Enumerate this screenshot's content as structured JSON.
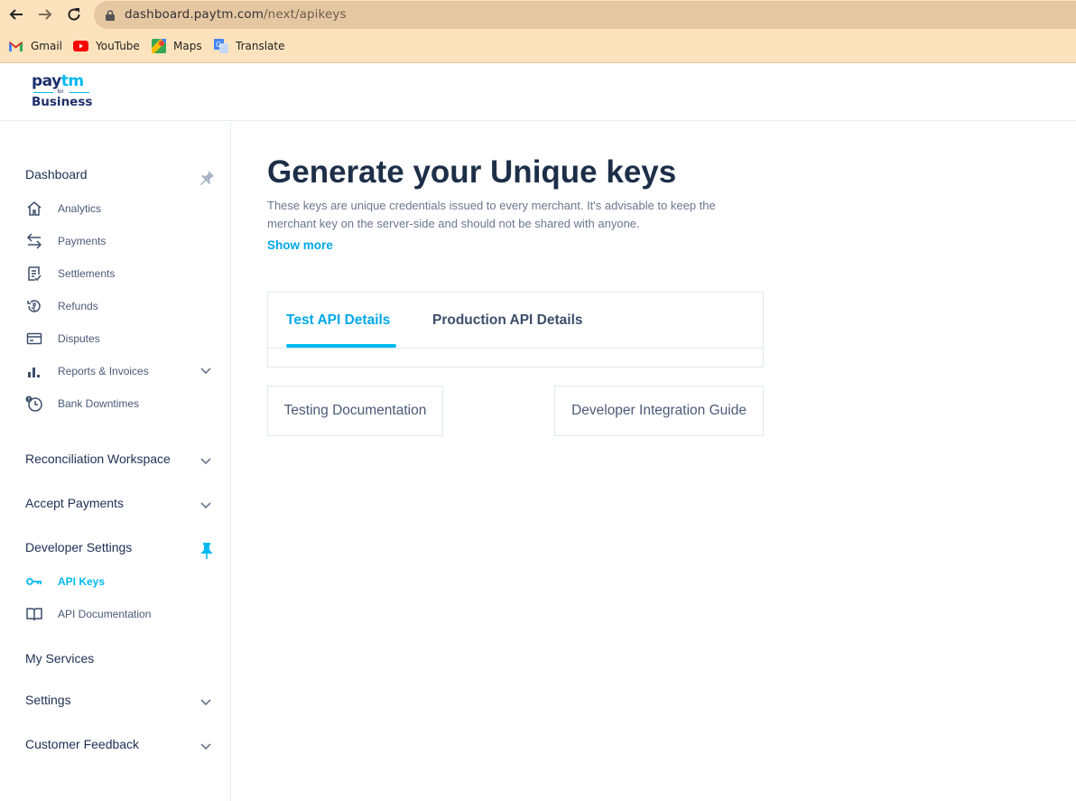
{
  "browser": {
    "url_host": "dashboard.paytm.com",
    "url_path": "/next/apikeys",
    "bookmarks": [
      {
        "label": "Gmail",
        "icon": "gmail-icon"
      },
      {
        "label": "YouTube",
        "icon": "youtube-icon"
      },
      {
        "label": "Maps",
        "icon": "maps-icon"
      },
      {
        "label": "Translate",
        "icon": "translate-icon"
      }
    ]
  },
  "logo": {
    "top": "pay",
    "top2": "tm",
    "for": "for",
    "bottom": "Business"
  },
  "sidebar": {
    "dashboard": "Dashboard",
    "items": [
      {
        "label": "Analytics",
        "icon": "home-icon"
      },
      {
        "label": "Payments",
        "icon": "transfer-arrows-icon"
      },
      {
        "label": "Settlements",
        "icon": "settlements-icon"
      },
      {
        "label": "Refunds",
        "icon": "refund-icon"
      },
      {
        "label": "Disputes",
        "icon": "card-icon"
      },
      {
        "label": "Reports & Invoices",
        "icon": "bar-chart-icon"
      },
      {
        "label": "Bank Downtimes",
        "icon": "clock-alert-icon"
      }
    ],
    "reconciliation": "Reconciliation Workspace",
    "accept_payments": "Accept Payments",
    "developer_settings": "Developer Settings",
    "dev_items": [
      {
        "label": "API Keys",
        "icon": "key-icon"
      },
      {
        "label": "API Documentation",
        "icon": "book-icon"
      }
    ],
    "my_services": "My Services",
    "settings": "Settings",
    "customer_feedback": "Customer Feedback"
  },
  "main": {
    "title": "Generate your Unique keys",
    "description": "These keys are unique credentials issued to every merchant. It's advisable to keep the merchant key on the server-side and should not be shared with anyone.",
    "show_more": "Show more",
    "tabs": [
      {
        "label": "Test API Details",
        "active": true
      },
      {
        "label": "Production API Details",
        "active": false
      }
    ],
    "testing_doc": "Testing Documentation",
    "dev_guide": "Developer Integration Guide"
  },
  "colors": {
    "accent": "#00b9f1",
    "navy": "#1d2f6b",
    "chrome": "#fde3bd"
  }
}
